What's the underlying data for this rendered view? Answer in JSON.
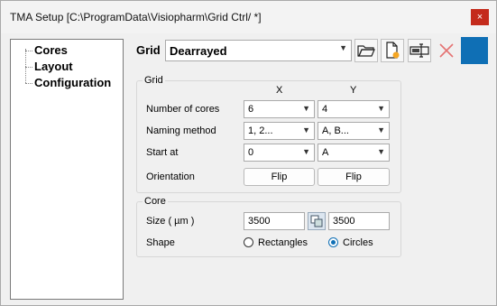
{
  "window": {
    "title": "TMA Setup [C:\\ProgramData\\Visiopharm\\Grid Ctrl/ *]",
    "close_icon": "×"
  },
  "tree": {
    "items": [
      "Cores",
      "Layout",
      "Configuration"
    ]
  },
  "header": {
    "grid_label": "Grid",
    "grid_value": "Dearrayed"
  },
  "grid_group": {
    "title": "Grid",
    "col_x": "X",
    "col_y": "Y",
    "number_of_cores": {
      "label": "Number of cores",
      "x": "6",
      "y": "4"
    },
    "naming_method": {
      "label": "Naming method",
      "x": "1, 2...",
      "y": "A, B..."
    },
    "start_at": {
      "label": "Start at",
      "x": "0",
      "y": "A"
    },
    "orientation": {
      "label": "Orientation",
      "x_button": "Flip",
      "y_button": "Flip"
    }
  },
  "core_group": {
    "title": "Core",
    "size_label": "Size ( µm )",
    "size_x": "3500",
    "size_y": "3500",
    "shape_label": "Shape",
    "shape_options": [
      "Rectangles",
      "Circles"
    ],
    "shape_selected": "Circles"
  },
  "colors": {
    "accent": "#0f6fb5",
    "close": "#c42b1c"
  }
}
